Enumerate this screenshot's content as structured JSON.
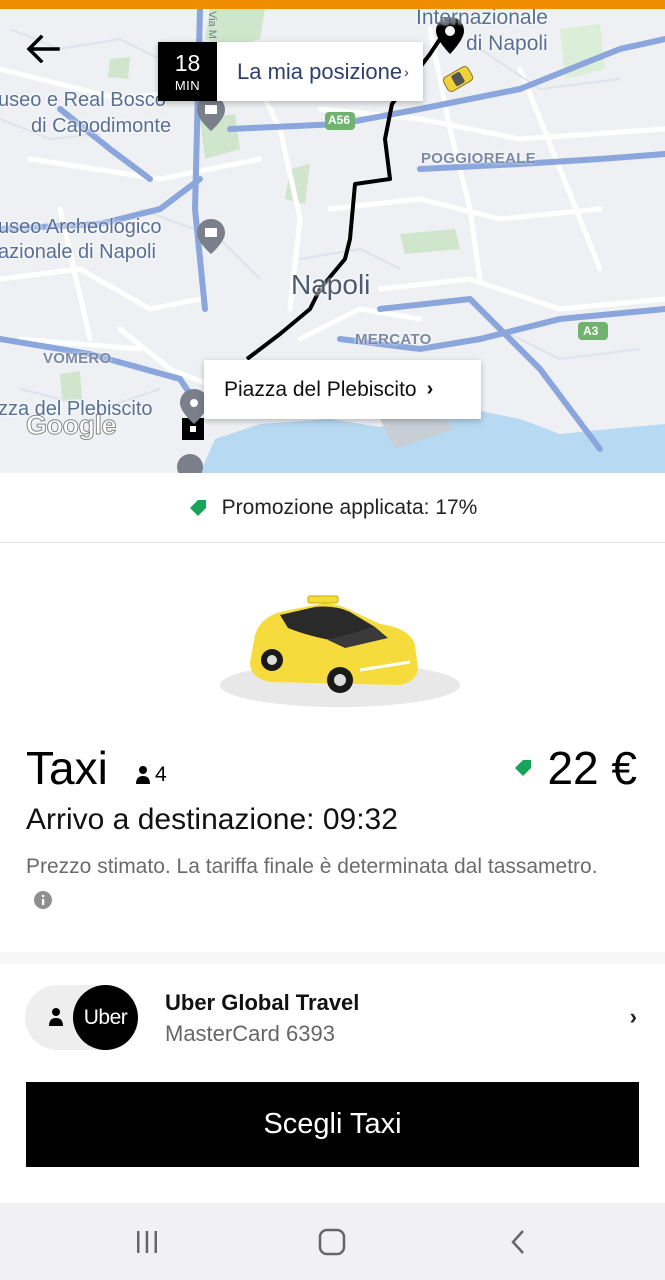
{
  "map": {
    "labels": {
      "internazionale": "Internazionale",
      "di_napoli": "di Napoli",
      "museo_real_bosco": "useo e Real Bosco",
      "di_capodimonte": "di Capodimonte",
      "a56": "A56",
      "poggioreale": "POGGIOREALE",
      "museo_archeologico": "useo Archeologico",
      "nazionale_di_napoli": "azionale di Napoli",
      "napoli": "Napoli",
      "mercato": "MERCATO",
      "a3": "A3",
      "vomero": "VOMERO",
      "piazza_plebiscito_map": "zza del Plebiscito",
      "via_m": "Via M"
    },
    "eta": {
      "value": "18",
      "unit": "MIN",
      "origin_label": "La mia posizione"
    },
    "destination_label": "Piazza del Plebiscito",
    "google_logo": "Google"
  },
  "promo": {
    "text": "Promozione applicata: 17%"
  },
  "product": {
    "name": "Taxi",
    "capacity": "4",
    "price": "22 €",
    "arrival": "Arrivo a destinazione: 09:32",
    "disclaimer": "Prezzo stimato. La tariffa finale è determinata dal tassametro."
  },
  "payment": {
    "badge": "Uber",
    "title": "Uber Global Travel",
    "subtitle": "MasterCard 6393"
  },
  "cta": {
    "label": "Scegli Taxi"
  },
  "colors": {
    "accent_promo": "#17a35a",
    "status_bar": "#f08c00",
    "route": "#000000",
    "cta_bg": "#000000"
  },
  "icons": {
    "back": "arrow-left-icon",
    "tag": "tag-icon",
    "person": "person-icon",
    "info": "info-icon",
    "chevron": "chevron-right-icon"
  }
}
